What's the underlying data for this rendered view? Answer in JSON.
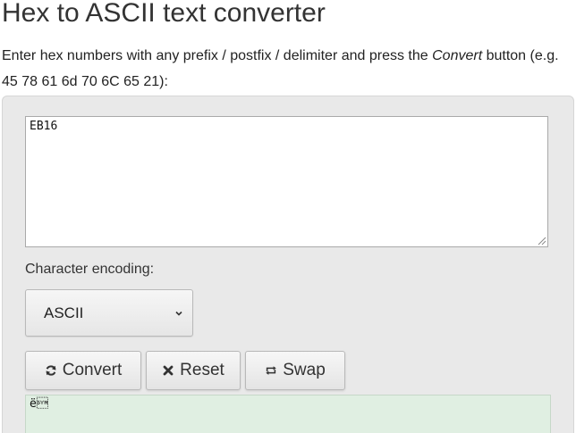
{
  "page": {
    "title": "Hex to ASCII text converter",
    "intro_before": "Enter hex numbers with any prefix / postfix / delimiter and press the ",
    "intro_em": "Convert",
    "intro_after": " button (e.g. 45 78 61 6d 70 6C 65 21):"
  },
  "form": {
    "hex_input_value": "EB16",
    "encoding_label": "Character encoding:",
    "encoding_selected": "ASCII",
    "buttons": {
      "convert": "Convert",
      "reset": "Reset",
      "swap": "Swap"
    },
    "output_value": "ë\u0016"
  },
  "icons": {
    "convert": "refresh-icon",
    "reset": "close-icon",
    "swap": "swap-icon",
    "select": "chevron-down-icon"
  },
  "colors": {
    "panel_bg": "#e9e9e9",
    "output_bg": "#e0efe2",
    "button_bg": "#eeeeee"
  }
}
